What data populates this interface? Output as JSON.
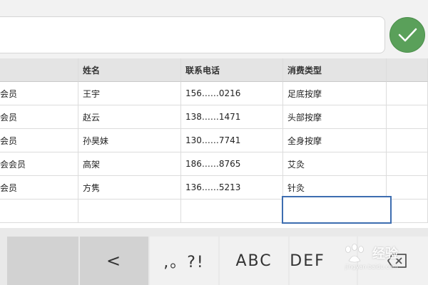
{
  "table": {
    "headers": [
      "",
      "姓名",
      "联系电话",
      "消费类型",
      ""
    ],
    "rows": [
      [
        "会员",
        "王宇",
        "156……0216",
        "足底按摩",
        ""
      ],
      [
        "会员",
        "赵云",
        "138……1471",
        "头部按摩",
        ""
      ],
      [
        "会员",
        "孙昊妹",
        "130……7741",
        "全身按摩",
        ""
      ],
      [
        "会会员",
        "高架",
        "186……8765",
        "艾灸",
        ""
      ],
      [
        "会员",
        "方隽",
        "136……5213",
        "针灸",
        ""
      ],
      [
        "",
        "",
        "",
        "",
        ""
      ]
    ]
  },
  "keyboard": {
    "back": "<",
    "punct": ",。?!",
    "abc": "ABC",
    "def": "DEF"
  },
  "watermark": {
    "title": "经验",
    "url": "jingyan.baidu.com"
  },
  "colors": {
    "confirm": "#5aa05a",
    "selection": "#3d6db0"
  }
}
